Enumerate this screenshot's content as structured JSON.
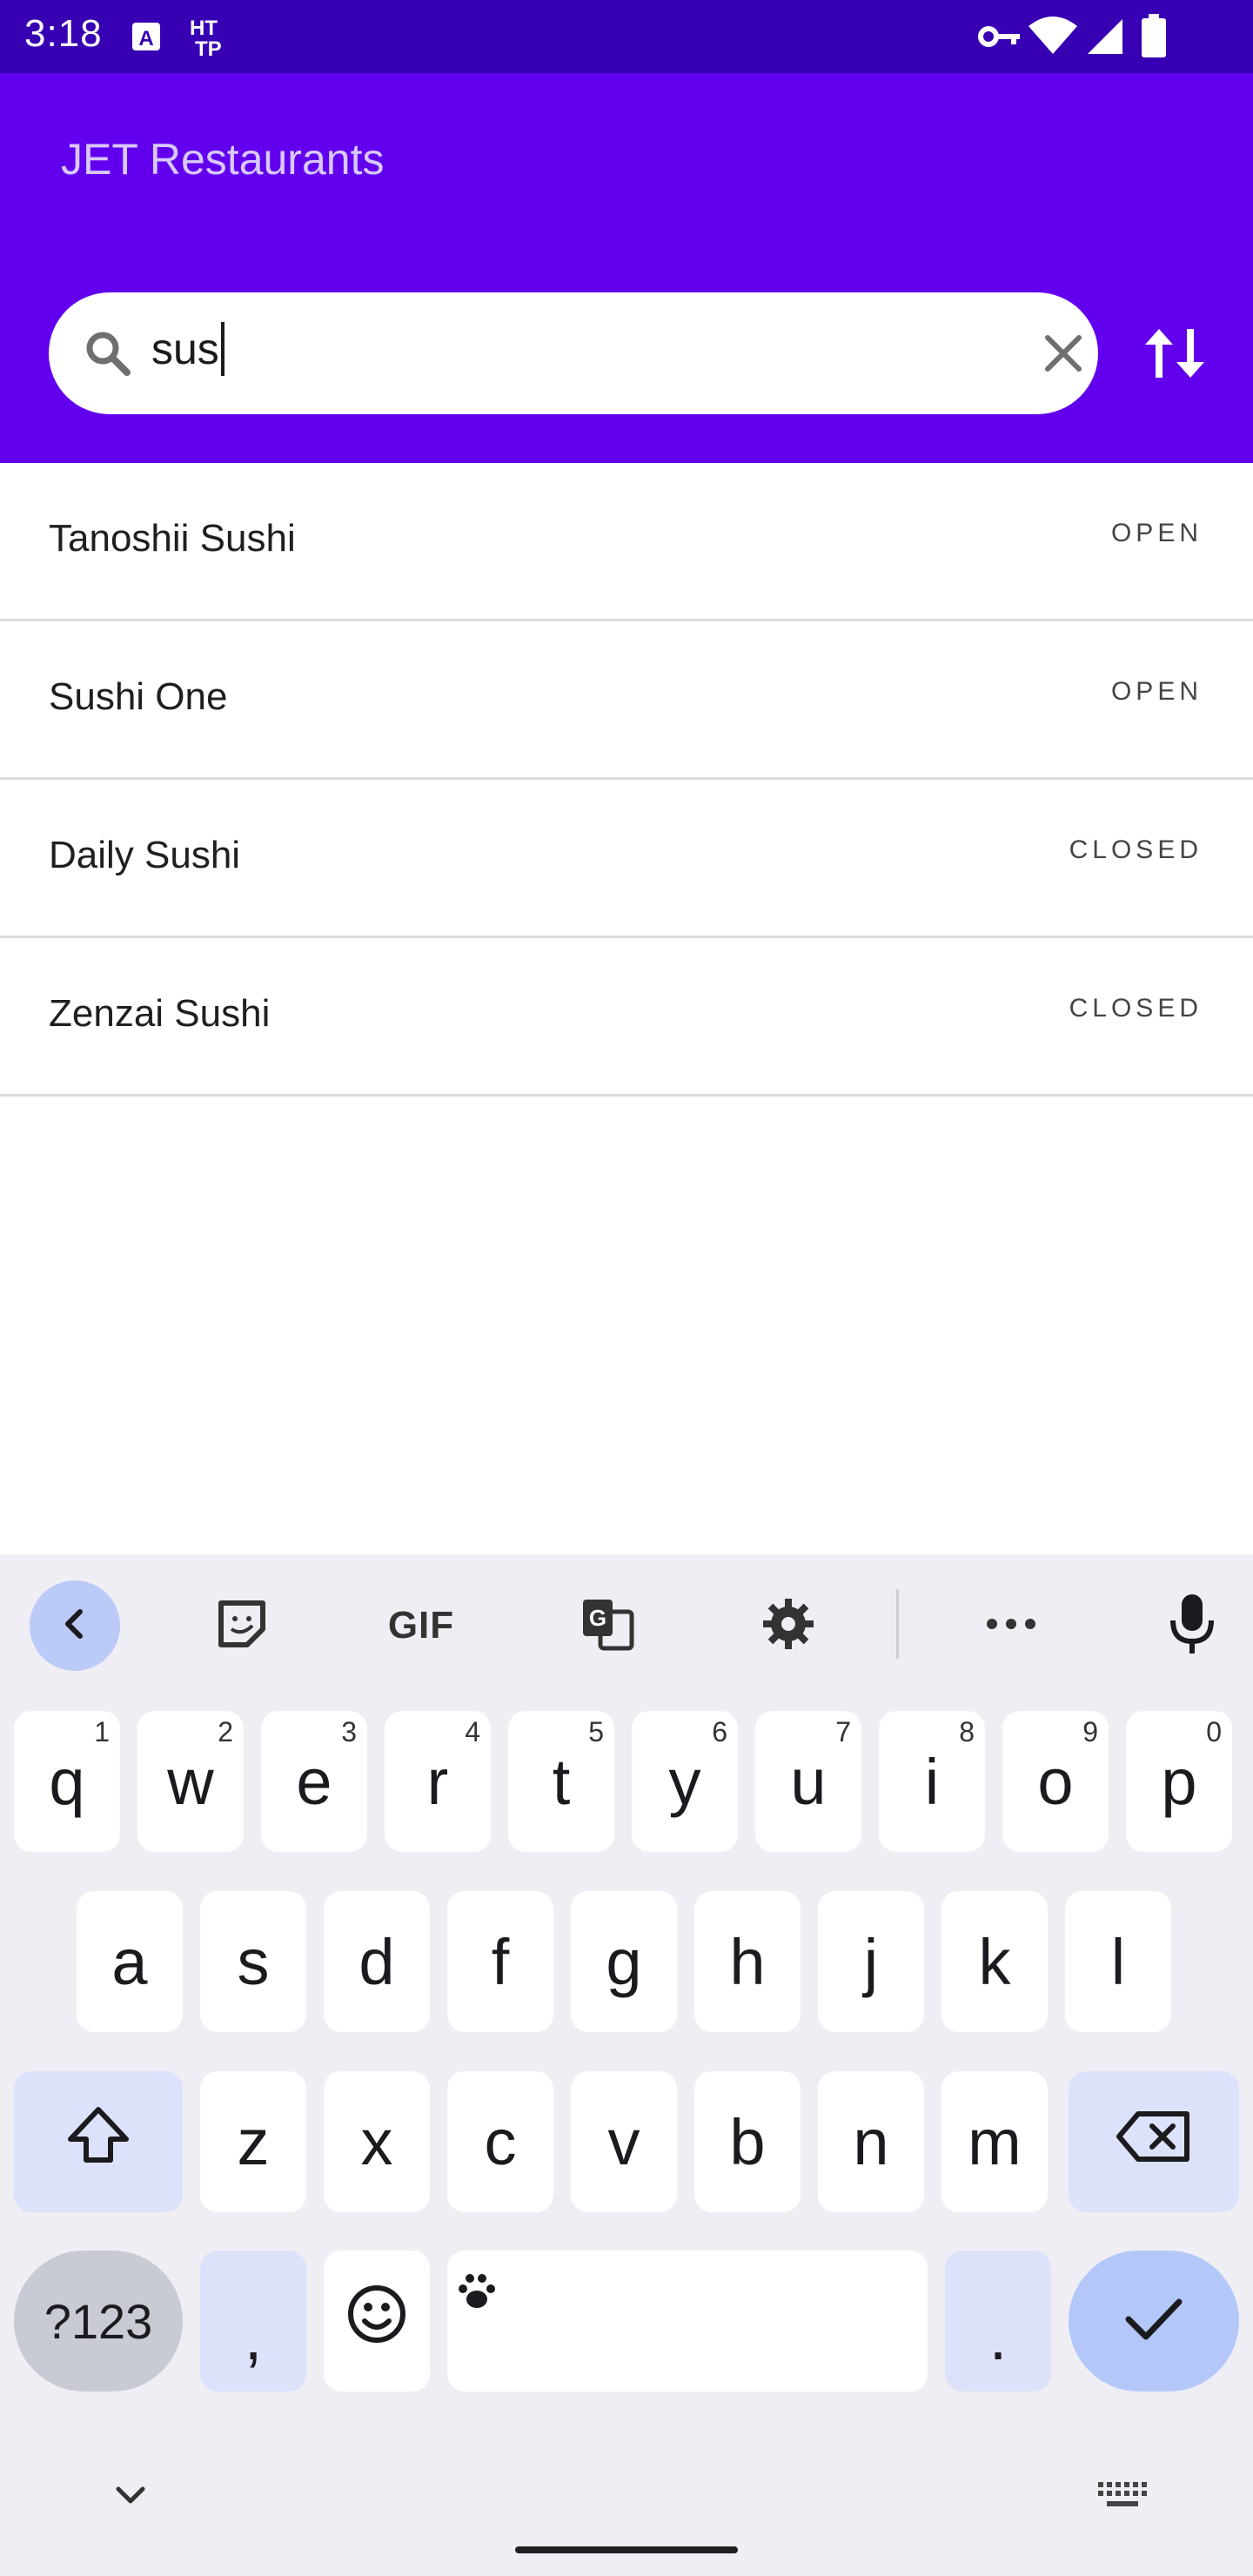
{
  "status_bar": {
    "time": "3:18"
  },
  "app": {
    "title": "JET Restaurants"
  },
  "search": {
    "value": "sus"
  },
  "restaurants": [
    {
      "name": "Tanoshii Sushi",
      "status": "OPEN"
    },
    {
      "name": "Sushi One",
      "status": "OPEN"
    },
    {
      "name": "Daily Sushi",
      "status": "CLOSED"
    },
    {
      "name": "Zenzai Sushi",
      "status": "CLOSED"
    }
  ],
  "keyboard": {
    "toolbar": {
      "gif_label": "GIF"
    },
    "row1": [
      {
        "key": "q",
        "hint": "1"
      },
      {
        "key": "w",
        "hint": "2"
      },
      {
        "key": "e",
        "hint": "3"
      },
      {
        "key": "r",
        "hint": "4"
      },
      {
        "key": "t",
        "hint": "5"
      },
      {
        "key": "y",
        "hint": "6"
      },
      {
        "key": "u",
        "hint": "7"
      },
      {
        "key": "i",
        "hint": "8"
      },
      {
        "key": "o",
        "hint": "9"
      },
      {
        "key": "p",
        "hint": "0"
      }
    ],
    "row2": [
      "a",
      "s",
      "d",
      "f",
      "g",
      "h",
      "j",
      "k",
      "l"
    ],
    "row3": [
      "z",
      "x",
      "c",
      "v",
      "b",
      "n",
      "m"
    ],
    "symbols_label": "?123",
    "comma": ",",
    "period": "."
  },
  "colors": {
    "status_bar": "#3700b3",
    "app_bar": "#6200ee",
    "keyboard_bg": "#f0eef5",
    "enter_key": "#b3c8f9"
  }
}
